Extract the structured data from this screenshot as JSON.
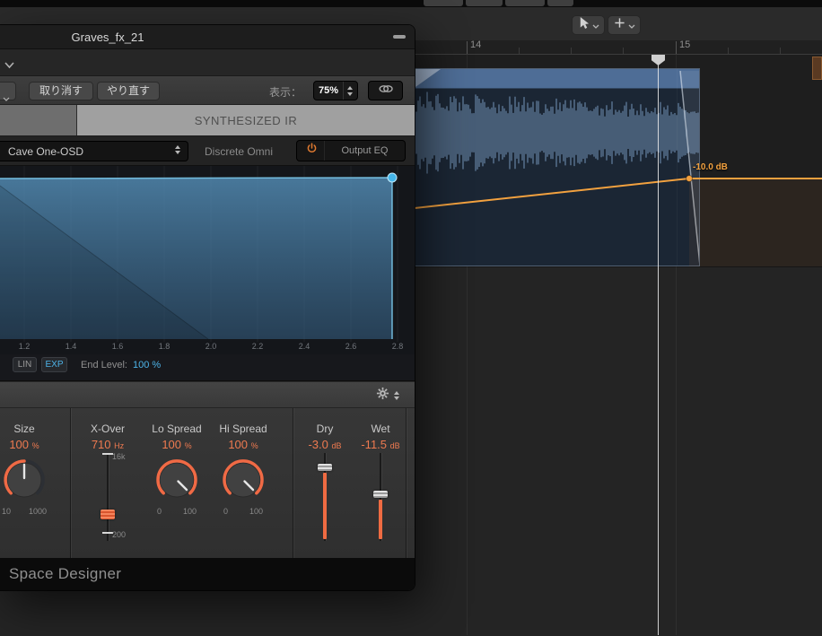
{
  "ruler": {
    "bar_labels": [
      "14",
      "15"
    ]
  },
  "automation": {
    "value_label": "-10.0 dB"
  },
  "plugin": {
    "title": "Graves_fx_21",
    "toolbar": {
      "undo": "取り消す",
      "redo": "やり直す",
      "view_label": "表示：",
      "zoom": "75%"
    },
    "tab_label": "SYNTHESIZED IR",
    "preset": {
      "name": "Cave One-OSD",
      "mode": "Discrete Omni",
      "output_eq": "Output EQ"
    },
    "display": {
      "ticks": [
        "1.2",
        "1.4",
        "1.6",
        "1.8",
        "2.0",
        "2.2",
        "2.4",
        "2.6",
        "2.8"
      ],
      "lin": "LIN",
      "exp": "EXP",
      "end_level_label": "End Level:",
      "end_level_value": "100 %"
    },
    "params": {
      "size": {
        "label": "Size",
        "value": "100",
        "unit": "%",
        "min": "10",
        "max": "1000"
      },
      "xover": {
        "label": "X-Over",
        "value": "710",
        "unit": "Hz",
        "top": "16k",
        "bottom": "200"
      },
      "lo_spread": {
        "label": "Lo Spread",
        "value": "100",
        "unit": "%",
        "min": "0",
        "max": "100"
      },
      "hi_spread": {
        "label": "Hi Spread",
        "value": "100",
        "unit": "%",
        "min": "0",
        "max": "100"
      },
      "dry": {
        "label": "Dry",
        "value": "-3.0",
        "unit": "dB"
      },
      "wet": {
        "label": "Wet",
        "value": "-11.5",
        "unit": "dB"
      }
    },
    "footer": "Space Designer"
  },
  "colors": {
    "accent_orange": "#ee7a50",
    "accent_blue": "#4db3e8",
    "automation_orange": "#f2a13f",
    "envelope_fill": "#4e85ad",
    "region_header": "#4e6d96"
  }
}
